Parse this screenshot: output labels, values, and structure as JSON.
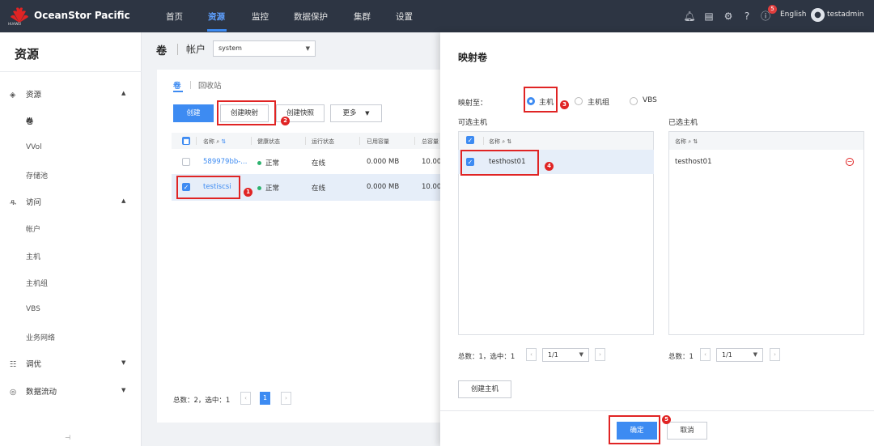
{
  "header": {
    "brand": "HUAWEI",
    "app_name": "OceanStor Pacific",
    "nav": [
      "首页",
      "资源",
      "监控",
      "数据保护",
      "集群",
      "设置"
    ],
    "active_nav": "资源",
    "notification_count": "5",
    "language": "English",
    "username": "testadmin",
    "icons": [
      "bell-icon",
      "document-icon",
      "gear-icon",
      "help-icon",
      "alert-icon",
      "user-icon"
    ]
  },
  "sidebar": {
    "title": "资源",
    "groups": [
      {
        "label": "资源",
        "icon": "layers-icon",
        "items": [
          "卷",
          "VVol",
          "存储池"
        ]
      },
      {
        "label": "访问",
        "icon": "users-icon",
        "items": [
          "帐户",
          "主机",
          "主机组",
          "VBS",
          "业务网络"
        ]
      },
      {
        "label": "调优",
        "icon": "tune-icon",
        "items": []
      },
      {
        "label": "数据流动",
        "icon": "flow-icon",
        "items": []
      }
    ],
    "collapse_label": "⊣"
  },
  "main": {
    "title": "卷",
    "account_label": "帐户",
    "account_value": "system",
    "tabs": [
      "卷",
      "回收站"
    ],
    "buttons": {
      "create": "创建",
      "create_mapping": "创建映射",
      "create_snapshot": "创建快照",
      "more": "更多"
    },
    "columns": [
      "名称",
      "健康状态",
      "运行状态",
      "已用容量",
      "总容量"
    ],
    "rows": [
      {
        "name": "589979bb-...",
        "health": "正常",
        "status": "在线",
        "used": "0.000 MB",
        "total": "10.00"
      },
      {
        "name": "testiscsi",
        "health": "正常",
        "status": "在线",
        "used": "0.000 MB",
        "total": "10.00"
      }
    ],
    "footer_summary": "总数：2，选中：1",
    "current_page": "1"
  },
  "dialog": {
    "title": "映射卷",
    "map_to_label": "映射至：",
    "options": [
      "主机",
      "主机组",
      "VBS"
    ],
    "selected_option": "主机",
    "available_title": "可选主机",
    "selected_title": "已选主机",
    "name_col": "名称",
    "available_hosts": [
      "testhost01"
    ],
    "selected_hosts": [
      "testhost01"
    ],
    "left_summary": "总数：1，选中：1",
    "right_summary": "总数：1",
    "page_value": "1/1",
    "create_host": "创建主机",
    "ok": "确定",
    "cancel": "取消"
  },
  "step_markers": [
    "1",
    "2",
    "3",
    "4",
    "5"
  ],
  "colors": {
    "accent": "#3d8bf2",
    "header_bg": "#2d3543",
    "marker": "#e02424",
    "healthy": "#2db36f"
  }
}
